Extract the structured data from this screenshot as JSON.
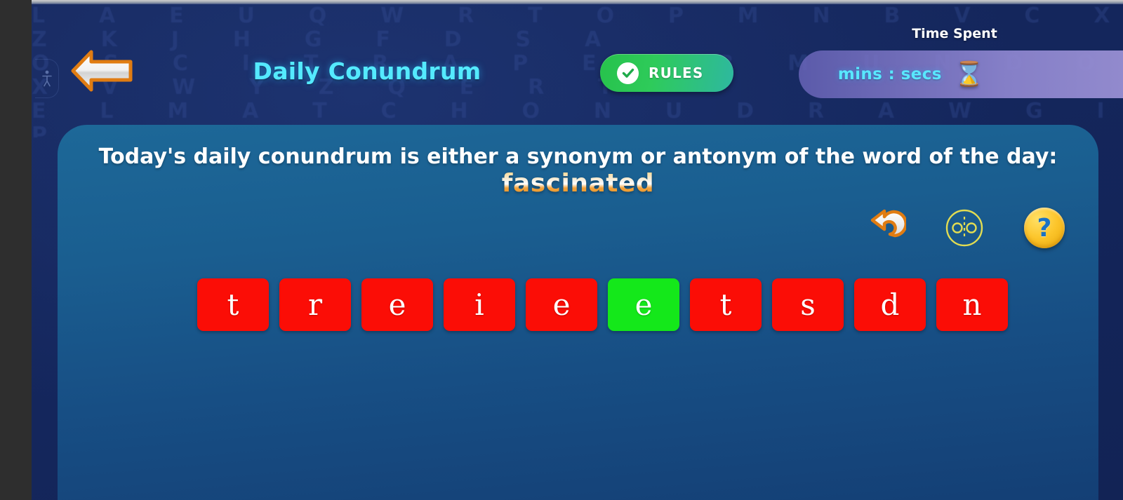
{
  "header": {
    "back_button_icon": "left-arrow-icon",
    "title": "Daily Conundrum",
    "rules_label": "RULES",
    "rules_icon": "check-circle-icon",
    "time_spent_label": "Time Spent",
    "timer_value": "mins : secs",
    "timer_icon": "hourglass-icon",
    "accessibility_icon": "accessibility-icon"
  },
  "panel": {
    "prompt": "Today's daily conundrum is either a synonym or antonym of the word of the day:",
    "word_of_the_day": "fascinated"
  },
  "actions": [
    {
      "name": "reset-icon",
      "label": "Reset"
    },
    {
      "name": "mirror-icon",
      "label": "Mirror"
    },
    {
      "name": "help-icon",
      "label": "?"
    }
  ],
  "tiles": [
    {
      "letter": "t",
      "state": "default"
    },
    {
      "letter": "r",
      "state": "default"
    },
    {
      "letter": "e",
      "state": "default"
    },
    {
      "letter": "i",
      "state": "default"
    },
    {
      "letter": "e",
      "state": "default"
    },
    {
      "letter": "e",
      "state": "selected"
    },
    {
      "letter": "t",
      "state": "default"
    },
    {
      "letter": "s",
      "state": "default"
    },
    {
      "letter": "d",
      "state": "default"
    },
    {
      "letter": "n",
      "state": "default"
    }
  ],
  "colors": {
    "title_cyan": "#54eaff",
    "rules_green": "#2ecb5a",
    "tile_red": "#fb0d06",
    "tile_green": "#14e81a",
    "panel_blue": "#1a5e90",
    "background_navy": "#14265c",
    "timer_purple": "#8e86d0",
    "accent_gold": "#fcc52b"
  },
  "texture_letters": "L  A  E  U  Q  W  R  T  O  P  M  N  B  V  C  X  Z  K  J  H  G  F  D  S  A\nO  S  C  I  T  R  A  P  E  L  B  M  U  N  D  O  X  V  W  Y  Z  Q  E  R  T\nE  L  M  A  T  C  H  O  N  U  D  R  A  W  G  I  P  S  K  B  V  F  Y  Q  J\nA  R  T  S  E  N  I  G  M  A  O  C  L  U  D  P  W  V  B  X  Z  H  K  F  R"
}
